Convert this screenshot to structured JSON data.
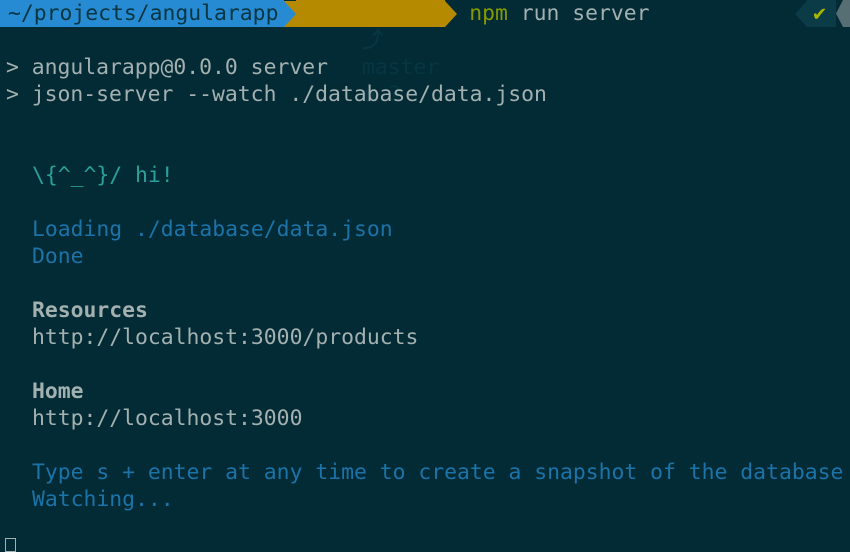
{
  "prompt": {
    "path": "~/projects/angularapp",
    "git_branch": "master",
    "git_status": "● ?",
    "command_bin": "npm",
    "command_args": " run server",
    "status_check": "✔"
  },
  "output": {
    "line1": "> angularapp@0.0.0 server",
    "line2": "> json-server --watch ./database/data.json",
    "greeting": "\\{^_^}/ hi!",
    "loading": "Loading ./database/data.json",
    "done": "Done",
    "resources_heading": "Resources",
    "resources_url": "http://localhost:3000/products",
    "home_heading": "Home",
    "home_url": "http://localhost:3000",
    "snapshot_hint": "Type s + enter at any time to create a snapshot of the database",
    "watching": "Watching..."
  }
}
